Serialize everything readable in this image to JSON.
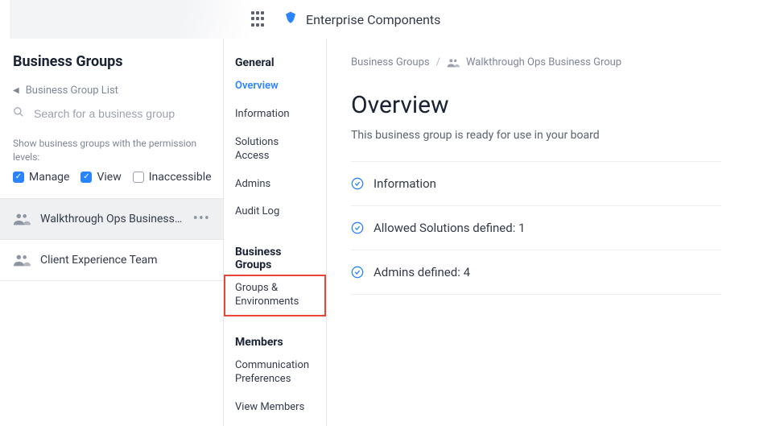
{
  "header": {
    "app_title": "Enterprise Components"
  },
  "left_panel": {
    "title": "Business Groups",
    "back_label": "Business Group List",
    "search_placeholder": "Search for a business group",
    "filters_label": "Show business groups with the permission levels:",
    "filters": {
      "manage": "Manage",
      "view": "View",
      "inaccessible": "Inaccessible"
    },
    "items": [
      {
        "label": "Walkthrough Ops Business …",
        "active": true,
        "has_more": true
      },
      {
        "label": "Client Experience Team",
        "active": false,
        "has_more": false
      }
    ]
  },
  "nav": {
    "general": {
      "header": "General",
      "overview": "Overview",
      "information": "Information",
      "solutions_access": "Solutions Access",
      "admins": "Admins",
      "audit_log": "Audit Log"
    },
    "business_groups": {
      "header": "Business Groups",
      "groups_envs": "Groups & Environments"
    },
    "members": {
      "header": "Members",
      "comm_prefs": "Communication Preferences",
      "view_members": "View Members"
    }
  },
  "breadcrumb": {
    "root": "Business Groups",
    "current": "Walkthrough Ops Business Group"
  },
  "page": {
    "title": "Overview",
    "subtitle": "This business group is ready for use in your board",
    "cards": {
      "information": "Information",
      "allowed_solutions": "Allowed Solutions defined: 1",
      "admins_defined": "Admins defined: 4"
    }
  }
}
